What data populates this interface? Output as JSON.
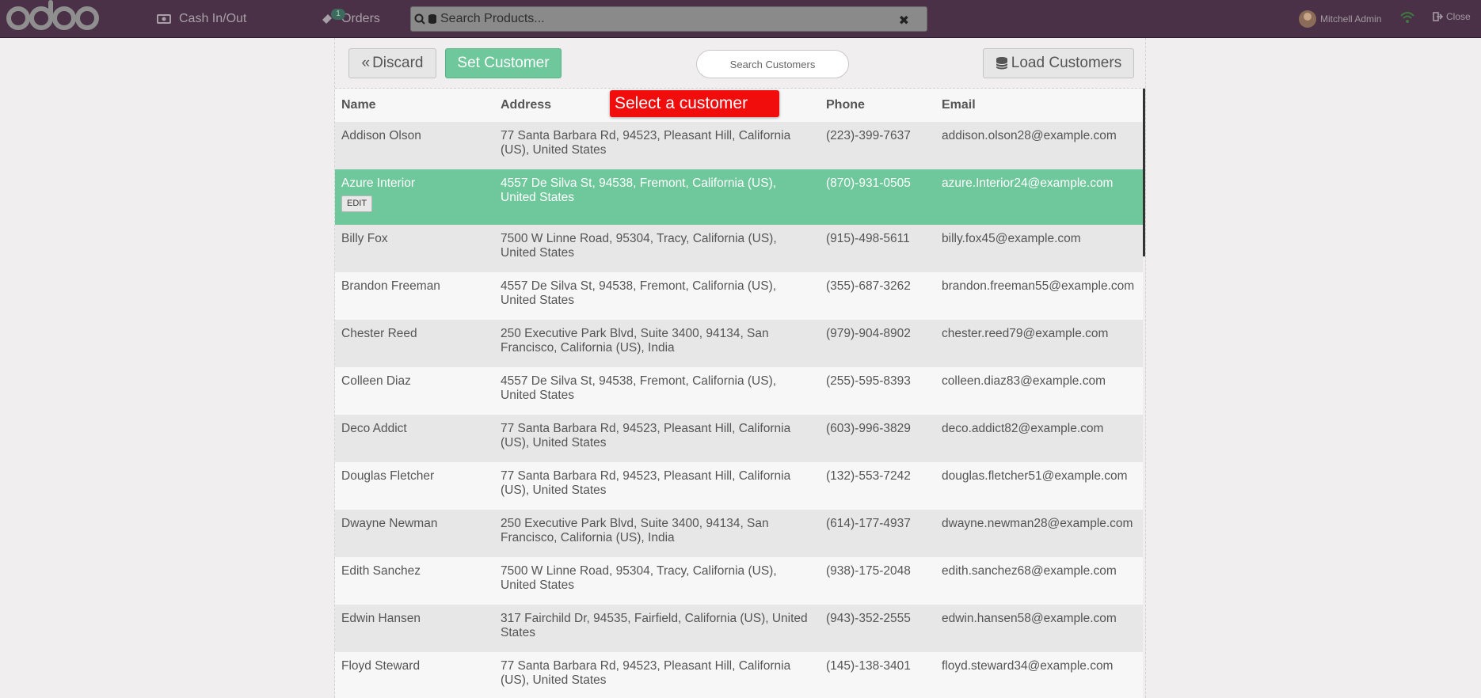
{
  "navbar": {
    "cash_label": "Cash In/Out",
    "orders_label": "Orders",
    "orders_badge": "1",
    "search_placeholder": "Search Products...",
    "clear_glyph": "✖",
    "user_name": "Mitchell Admin",
    "close_label": "Close"
  },
  "toolbar": {
    "discard_label": "Discard",
    "discard_glyph": "«",
    "set_customer_label": "Set Customer",
    "search_placeholder": "Search Customers",
    "load_customers_label": "Load Customers"
  },
  "tooltip": "Select a customer",
  "table": {
    "headers": [
      "Name",
      "Address",
      "Phone",
      "Email"
    ],
    "edit_label": "EDIT",
    "rows": [
      {
        "name": "Addison Olson",
        "address": "77 Santa Barbara Rd, 94523, Pleasant Hill, California (US), United States",
        "phone": "(223)-399-7637",
        "email": "addison.olson28@example.com"
      },
      {
        "name": "Azure Interior",
        "address": "4557 De Silva St, 94538, Fremont, California (US), United States",
        "phone": "(870)-931-0505",
        "email": "azure.Interior24@example.com"
      },
      {
        "name": "Billy Fox",
        "address": "7500 W Linne Road, 95304, Tracy, California (US), United States",
        "phone": "(915)-498-5611",
        "email": "billy.fox45@example.com"
      },
      {
        "name": "Brandon Freeman",
        "address": "4557 De Silva St, 94538, Fremont, California (US), United States",
        "phone": "(355)-687-3262",
        "email": "brandon.freeman55@example.com"
      },
      {
        "name": "Chester Reed",
        "address": "250 Executive Park Blvd, Suite 3400, 94134, San Francisco, California (US), India",
        "phone": "(979)-904-8902",
        "email": "chester.reed79@example.com"
      },
      {
        "name": "Colleen Diaz",
        "address": "4557 De Silva St, 94538, Fremont, California (US), United States",
        "phone": "(255)-595-8393",
        "email": "colleen.diaz83@example.com"
      },
      {
        "name": "Deco Addict",
        "address": "77 Santa Barbara Rd, 94523, Pleasant Hill, California (US), United States",
        "phone": "(603)-996-3829",
        "email": "deco.addict82@example.com"
      },
      {
        "name": "Douglas Fletcher",
        "address": "77 Santa Barbara Rd, 94523, Pleasant Hill, California (US), United States",
        "phone": "(132)-553-7242",
        "email": "douglas.fletcher51@example.com"
      },
      {
        "name": "Dwayne Newman",
        "address": "250 Executive Park Blvd, Suite 3400, 94134, San Francisco, California (US), India",
        "phone": "(614)-177-4937",
        "email": "dwayne.newman28@example.com"
      },
      {
        "name": "Edith Sanchez",
        "address": "7500 W Linne Road, 95304, Tracy, California (US), United States",
        "phone": "(938)-175-2048",
        "email": "edith.sanchez68@example.com"
      },
      {
        "name": "Edwin Hansen",
        "address": "317 Fairchild Dr, 94535, Fairfield, California (US), United States",
        "phone": "(943)-352-2555",
        "email": "edwin.hansen58@example.com"
      },
      {
        "name": "Floyd Steward",
        "address": "77 Santa Barbara Rd, 94523, Pleasant Hill, California (US), United States",
        "phone": "(145)-138-3401",
        "email": "floyd.steward34@example.com"
      }
    ]
  },
  "colors": {
    "navbar": "#4b3147",
    "selected_row": "#6ec89b",
    "tooltip": "#f20d0d"
  }
}
